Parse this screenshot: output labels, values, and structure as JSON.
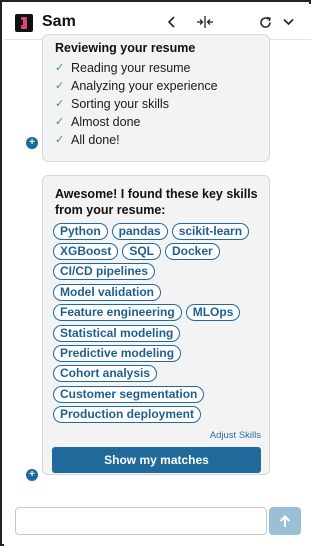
{
  "header": {
    "title": "Sam",
    "icons": [
      "app-logo-icon",
      "chevron-left-icon",
      "collapse-icon",
      "refresh-icon",
      "chevron-down-icon"
    ]
  },
  "progress": {
    "title": "Reviewing your resume",
    "steps": [
      {
        "label": "Reading your resume",
        "done": true
      },
      {
        "label": "Analyzing your experience",
        "done": true
      },
      {
        "label": "Sorting your skills",
        "done": true
      },
      {
        "label": "Almost done",
        "done": true
      },
      {
        "label": "All done!",
        "done": true
      }
    ]
  },
  "skills": {
    "title": "Awesome! I found these key skills from your resume:",
    "rows": [
      [
        "Python",
        "pandas",
        "scikit-learn"
      ],
      [
        "XGBoost",
        "SQL",
        "Docker"
      ],
      [
        "CI/CD pipelines"
      ],
      [
        "Model validation"
      ],
      [
        "Feature engineering",
        "MLOps"
      ],
      [
        "Statistical modeling"
      ],
      [
        "Predictive modeling"
      ],
      [
        "Cohort analysis"
      ],
      [
        "Customer segmentation"
      ],
      [
        "Production deployment"
      ]
    ],
    "adjust_label": "Adjust Skills",
    "cta_label": "Show my matches"
  },
  "composer": {
    "placeholder": "",
    "value": ""
  },
  "colors": {
    "accent": "#1f6a9a",
    "chip_border": "#1f6aa0",
    "check": "#3b9a4a",
    "logo_accent": "#e0427a",
    "send_disabled": "#9bbfd6"
  }
}
